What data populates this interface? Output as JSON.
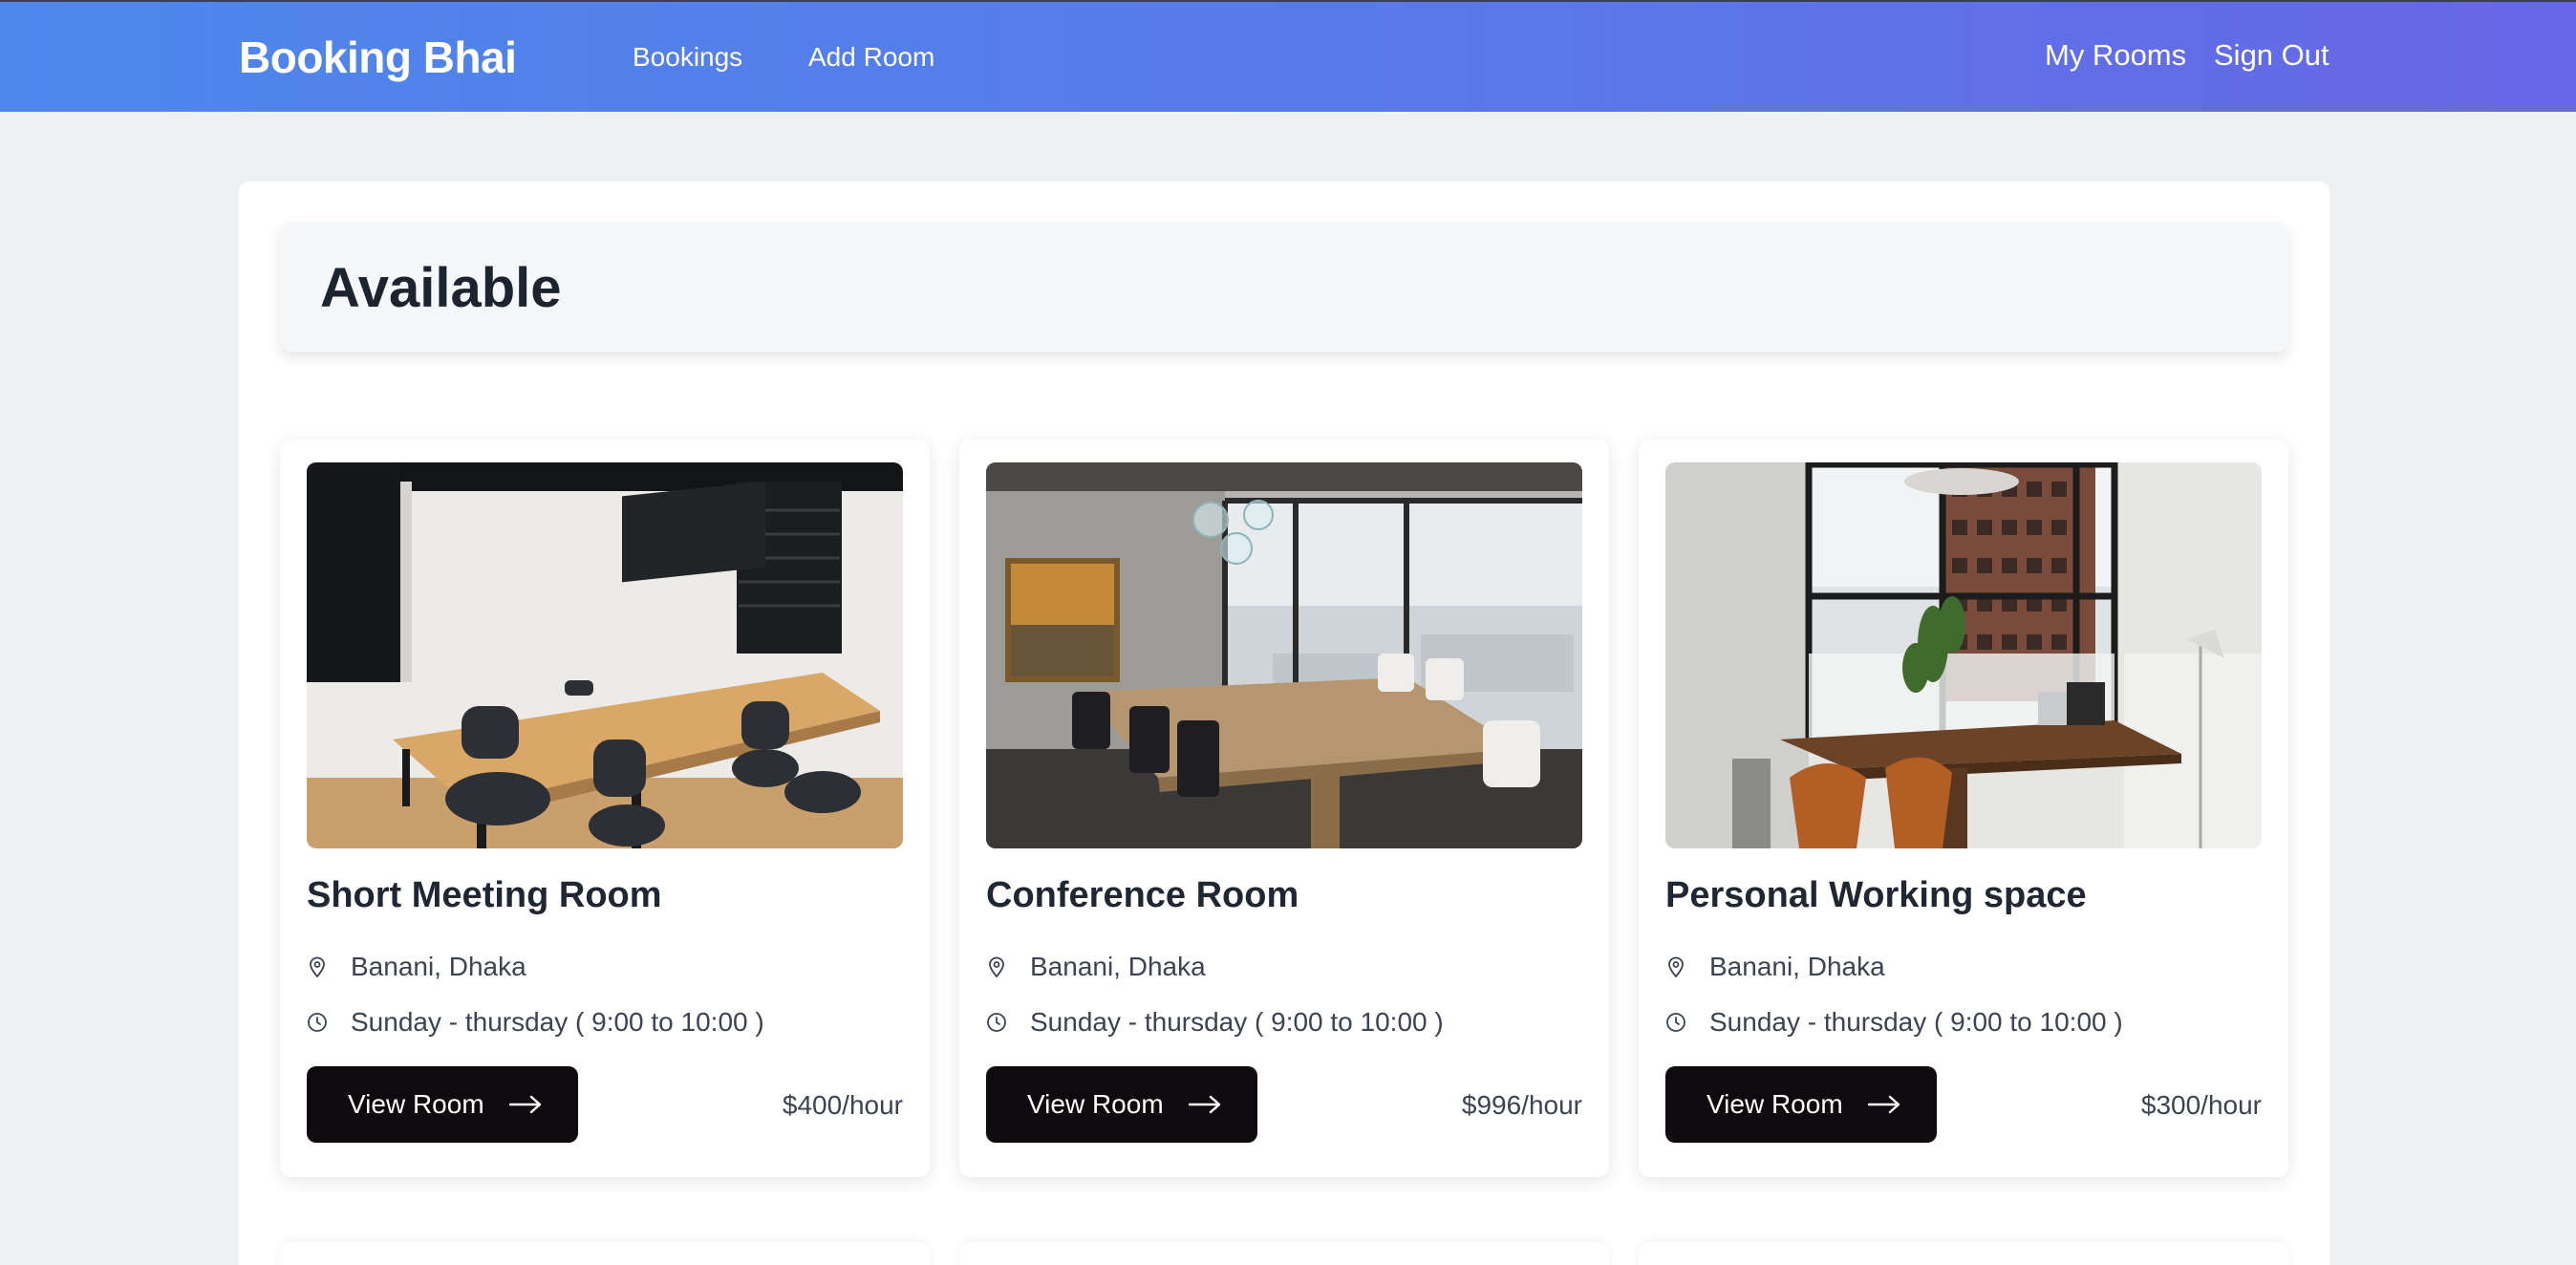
{
  "navbar": {
    "brand": "Booking Bhai",
    "links": [
      "Bookings",
      "Add Room"
    ],
    "right_links": [
      "My Rooms",
      "Sign Out"
    ]
  },
  "section": {
    "heading": "Available"
  },
  "rooms": [
    {
      "title": "Short Meeting Room",
      "location": "Banani, Dhaka",
      "schedule": "Sunday - thursday ( 9:00 to 10:00 )",
      "button_label": "View Room",
      "price": "$400/hour"
    },
    {
      "title": "Conference Room",
      "location": "Banani, Dhaka",
      "schedule": "Sunday - thursday ( 9:00 to 10:00 )",
      "button_label": "View Room",
      "price": "$996/hour"
    },
    {
      "title": "Personal Working space",
      "location": "Banani, Dhaka",
      "schedule": "Sunday - thursday ( 9:00 to 10:00 )",
      "button_label": "View Room",
      "price": "$300/hour"
    }
  ],
  "icons": {
    "location": "map-pin-icon",
    "schedule": "clock-icon",
    "button": "arrow-right-icon"
  },
  "colors": {
    "navbar_start": "#4d87ec",
    "navbar_end": "#6766e6",
    "button_bg": "#0f0a0e",
    "page_bg": "#eef1f4"
  }
}
